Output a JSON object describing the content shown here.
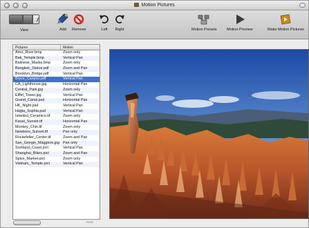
{
  "window": {
    "title": "Motion Pictures"
  },
  "toolbar": {
    "view_label": "View",
    "add_label": "Add",
    "remove_label": "Remove",
    "left_label": "Left",
    "right_label": "Right",
    "motion_presets_label": "Motion Presets",
    "motion_preview_label": "Motion Preview",
    "make_motion_pictures_label": "Make Motion Pictures"
  },
  "table": {
    "headers": [
      "Pictures",
      "Motion"
    ],
    "rows": [
      {
        "picture": "Arno_River.bmp",
        "motion": "Zoom only"
      },
      {
        "picture": "Bak_Temple.bmp",
        "motion": "Vertical Pan"
      },
      {
        "picture": "Balinese_Masks.bmp",
        "motion": "Zoom only"
      },
      {
        "picture": "Bangkok_Statue.pdf",
        "motion": "Zoom and Pan"
      },
      {
        "picture": "Brooklyn_Bridge.pdf",
        "motion": "Vertical Pan"
      },
      {
        "picture": "Bryce_Canyon.pdf",
        "motion": "Vertical Pan"
      },
      {
        "picture": "CA_Lighthouse.jpg",
        "motion": "Horizontal Pan"
      },
      {
        "picture": "Central_Park.jpg",
        "motion": "Zoom only"
      },
      {
        "picture": "Eiffel_Tower.jpg",
        "motion": "Vertical Pan"
      },
      {
        "picture": "Grand_Canal.psd",
        "motion": "Horizontal Pan"
      },
      {
        "picture": "HK_Night.psd",
        "motion": "Vertical Pan"
      },
      {
        "picture": "Hagia_Sophia.psd",
        "motion": "Vertical Pan"
      },
      {
        "picture": "Istanbul_Ceramics.tif",
        "motion": "Zoom only"
      },
      {
        "picture": "Kauai_Sunset.tif",
        "motion": "Horizontal Pan"
      },
      {
        "picture": "Monkey_Chin.tif",
        "motion": "Zoom only"
      },
      {
        "picture": "Newborn_Sunset.tif",
        "motion": "Pan only"
      },
      {
        "picture": "Rockefeller_Center.tif",
        "motion": "Zoom and Pan"
      },
      {
        "picture": "San_Giorgio_Maggiore.jpg",
        "motion": "Pan only"
      },
      {
        "picture": "Scotland_Coast.pict",
        "motion": "Vertical Pan"
      },
      {
        "picture": "Shanghai_Bikes.pict",
        "motion": "Zoom and Pan"
      },
      {
        "picture": "Spice_Market.pict",
        "motion": "Zoom only"
      },
      {
        "picture": "Vietnam_Temple.pict",
        "motion": "Vertical Pan"
      }
    ],
    "selected_index": 5
  },
  "colors": {
    "selection": "#3d74c9",
    "row_stripe": "#eef3fb"
  }
}
